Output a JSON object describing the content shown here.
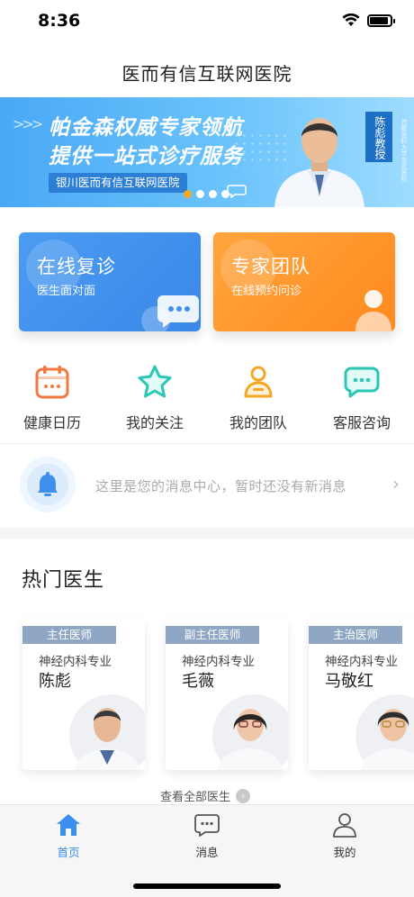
{
  "status_bar": {
    "time": "8:36"
  },
  "header": {
    "title": "医而有信互联网医院"
  },
  "banner": {
    "headline_line1": "帕金森权威专家领航",
    "headline_line2": "提供一站式诊疗服务",
    "tag": "银川医而有信互联网医院",
    "doctor_name": "陈彪教授",
    "doctor_subtitle": "首都医科大学宣武医院",
    "slide_count": 4,
    "active_slide": 1
  },
  "services": [
    {
      "title": "在线复诊",
      "subtitle": "医生面对面",
      "color": "#3f8fec"
    },
    {
      "title": "专家团队",
      "subtitle": "在线预约问诊",
      "color": "#ff9729"
    }
  ],
  "quick_entries": [
    {
      "label": "健康日历",
      "icon": "calendar-icon",
      "color": "#f07a3f"
    },
    {
      "label": "我的关注",
      "icon": "star-icon",
      "color": "#2cc6b4"
    },
    {
      "label": "我的团队",
      "icon": "team-icon",
      "color": "#f5a623"
    },
    {
      "label": "客服咨询",
      "icon": "chat-icon",
      "color": "#2cc6b4"
    }
  ],
  "message_center": {
    "text": "这里是您的消息中心，暂时还没有新消息"
  },
  "hot_doctors": {
    "title": "热门医生",
    "view_all": "查看全部医生",
    "items": [
      {
        "title": "主任医师",
        "dept": "神经内科专业",
        "name": "陈彪"
      },
      {
        "title": "副主任医师",
        "dept": "神经内科专业",
        "name": "毛薇"
      },
      {
        "title": "主治医师",
        "dept": "神经内科专业",
        "name": "马敬红"
      }
    ]
  },
  "tabbar": {
    "items": [
      {
        "label": "首页",
        "icon": "home-icon",
        "active": true
      },
      {
        "label": "消息",
        "icon": "message-icon",
        "active": false
      },
      {
        "label": "我的",
        "icon": "user-icon",
        "active": false
      }
    ],
    "active_color": "#3b8ff0"
  }
}
